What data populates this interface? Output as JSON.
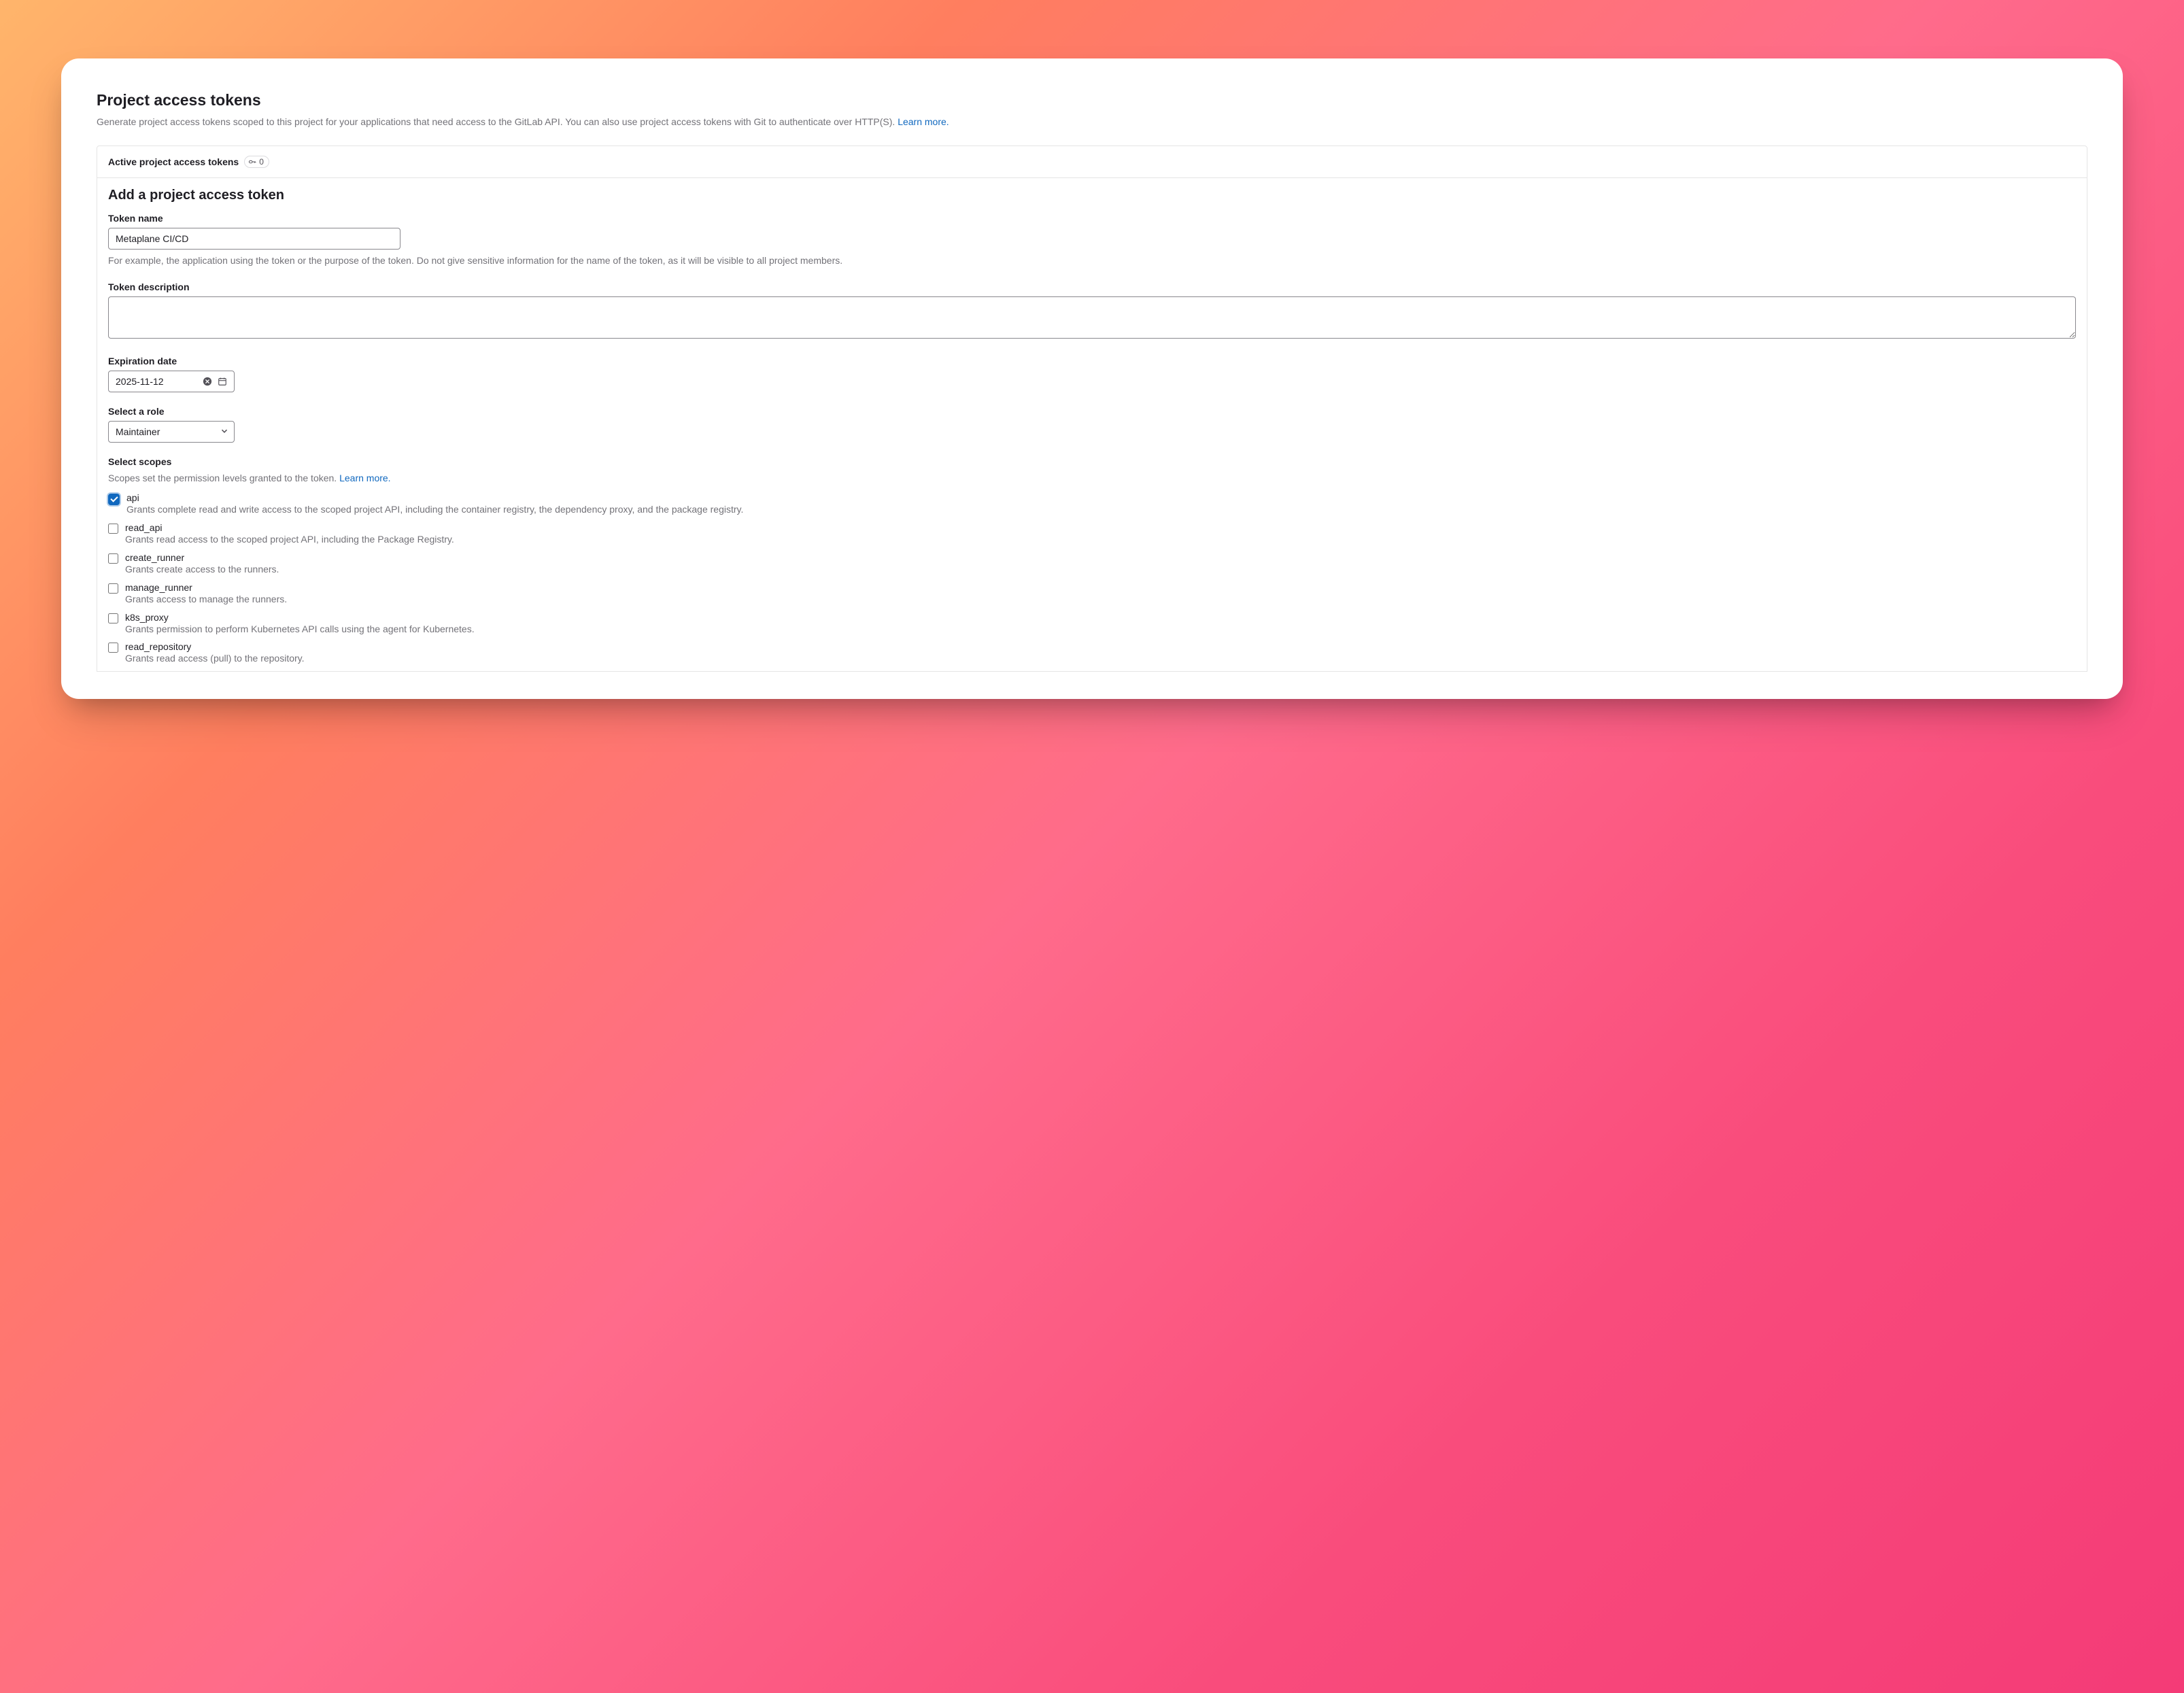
{
  "page": {
    "title": "Project access tokens",
    "subtitle_prefix": "Generate project access tokens scoped to this project for your applications that need access to the GitLab API. You can also use project access tokens with Git to authenticate over HTTP(S). ",
    "learn_more": "Learn more."
  },
  "active": {
    "title": "Active project access tokens",
    "count": "0"
  },
  "form": {
    "heading": "Add a project access token",
    "token_name": {
      "label": "Token name",
      "value": "Metaplane CI/CD",
      "help": "For example, the application using the token or the purpose of the token. Do not give sensitive information for the name of the token, as it will be visible to all project members."
    },
    "token_description": {
      "label": "Token description",
      "value": ""
    },
    "expiration": {
      "label": "Expiration date",
      "value": "2025-11-12"
    },
    "role": {
      "label": "Select a role",
      "value": "Maintainer"
    },
    "scopes": {
      "label": "Select scopes",
      "help_prefix": "Scopes set the permission levels granted to the token. ",
      "learn_more": "Learn more.",
      "items": [
        {
          "key": "api",
          "checked": true,
          "desc": "Grants complete read and write access to the scoped project API, including the container registry, the dependency proxy, and the package registry."
        },
        {
          "key": "read_api",
          "checked": false,
          "desc": "Grants read access to the scoped project API, including the Package Registry."
        },
        {
          "key": "create_runner",
          "checked": false,
          "desc": "Grants create access to the runners."
        },
        {
          "key": "manage_runner",
          "checked": false,
          "desc": "Grants access to manage the runners."
        },
        {
          "key": "k8s_proxy",
          "checked": false,
          "desc": "Grants permission to perform Kubernetes API calls using the agent for Kubernetes."
        },
        {
          "key": "read_repository",
          "checked": false,
          "desc": "Grants read access (pull) to the repository."
        }
      ]
    }
  }
}
